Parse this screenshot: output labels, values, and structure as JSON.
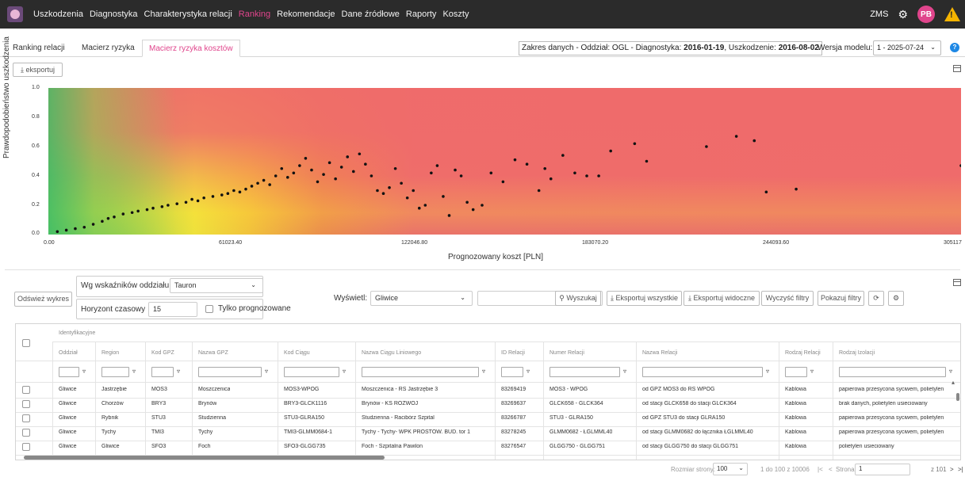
{
  "nav": {
    "items": [
      "Uszkodzenia",
      "Diagnostyka",
      "Charakterystyka relacji",
      "Ranking",
      "Rekomendacje",
      "Dane źródłowe",
      "Raporty",
      "Koszty"
    ],
    "active": "Ranking",
    "user_code": "ZMS",
    "avatar_initials": "PB",
    "warning_glyph": "!"
  },
  "tabs": [
    "Ranking relacji",
    "Macierz ryzyka",
    "Macierz ryzyka kosztów"
  ],
  "active_tab": "Macierz ryzyka kosztów",
  "range": {
    "prefix": "Zakres danych - Oddział: OGL - Diagnostyka: ",
    "diag_date": "2016-01-19",
    "mid": ", Uszkodzenie: ",
    "fail_date": "2016-08-02"
  },
  "model": {
    "label": "Wersja modelu:",
    "value": "1 - 2025-07-24"
  },
  "export_label": "eksportuj",
  "chart_data": {
    "type": "scatter",
    "xlabel": "Prognozowany koszt [PLN]",
    "ylabel": "Prawdopodobieństwo uszkodzenia",
    "xlim": [
      0,
      305117
    ],
    "ylim": [
      0,
      1
    ],
    "x_ticks": [
      "0.00",
      "61023.40",
      "122046.80",
      "183070.20",
      "244093.60",
      "305117"
    ],
    "y_ticks": [
      "1.0",
      "0.8",
      "0.6",
      "0.4",
      "0.2",
      "0.0"
    ],
    "points": [
      [
        3000,
        0.02
      ],
      [
        6000,
        0.03
      ],
      [
        9000,
        0.04
      ],
      [
        12000,
        0.05
      ],
      [
        15000,
        0.07
      ],
      [
        18000,
        0.09
      ],
      [
        20000,
        0.11
      ],
      [
        22000,
        0.12
      ],
      [
        25000,
        0.14
      ],
      [
        28000,
        0.15
      ],
      [
        30000,
        0.16
      ],
      [
        33000,
        0.17
      ],
      [
        35000,
        0.18
      ],
      [
        38000,
        0.19
      ],
      [
        40000,
        0.2
      ],
      [
        43000,
        0.21
      ],
      [
        46000,
        0.22
      ],
      [
        48000,
        0.24
      ],
      [
        50000,
        0.23
      ],
      [
        52000,
        0.25
      ],
      [
        55000,
        0.26
      ],
      [
        58000,
        0.27
      ],
      [
        60000,
        0.28
      ],
      [
        62000,
        0.3
      ],
      [
        64000,
        0.29
      ],
      [
        66000,
        0.31
      ],
      [
        68000,
        0.33
      ],
      [
        70000,
        0.35
      ],
      [
        72000,
        0.37
      ],
      [
        74000,
        0.34
      ],
      [
        76000,
        0.4
      ],
      [
        78000,
        0.45
      ],
      [
        80000,
        0.39
      ],
      [
        82000,
        0.42
      ],
      [
        84000,
        0.47
      ],
      [
        86000,
        0.52
      ],
      [
        88000,
        0.44
      ],
      [
        90000,
        0.36
      ],
      [
        92000,
        0.41
      ],
      [
        94000,
        0.49
      ],
      [
        96000,
        0.38
      ],
      [
        98000,
        0.46
      ],
      [
        100000,
        0.53
      ],
      [
        102000,
        0.43
      ],
      [
        104000,
        0.55
      ],
      [
        106000,
        0.48
      ],
      [
        108000,
        0.4
      ],
      [
        110000,
        0.3
      ],
      [
        112000,
        0.28
      ],
      [
        114000,
        0.32
      ],
      [
        116000,
        0.45
      ],
      [
        118000,
        0.35
      ],
      [
        120000,
        0.25
      ],
      [
        122000,
        0.3
      ],
      [
        124000,
        0.18
      ],
      [
        126000,
        0.2
      ],
      [
        128000,
        0.42
      ],
      [
        130000,
        0.47
      ],
      [
        132000,
        0.26
      ],
      [
        134000,
        0.13
      ],
      [
        136000,
        0.44
      ],
      [
        138000,
        0.4
      ],
      [
        140000,
        0.22
      ],
      [
        142000,
        0.17
      ],
      [
        145000,
        0.2
      ],
      [
        148000,
        0.42
      ],
      [
        152000,
        0.36
      ],
      [
        156000,
        0.51
      ],
      [
        160000,
        0.48
      ],
      [
        164000,
        0.3
      ],
      [
        166000,
        0.45
      ],
      [
        168000,
        0.38
      ],
      [
        172000,
        0.54
      ],
      [
        176000,
        0.42
      ],
      [
        180000,
        0.4
      ],
      [
        184000,
        0.4
      ],
      [
        188000,
        0.57
      ],
      [
        196000,
        0.62
      ],
      [
        200000,
        0.5
      ],
      [
        220000,
        0.6
      ],
      [
        230000,
        0.67
      ],
      [
        236000,
        0.64
      ],
      [
        240000,
        0.29
      ],
      [
        250000,
        0.31
      ],
      [
        305117,
        0.47
      ]
    ]
  },
  "controls": {
    "refresh_label": "Odśwież wykres",
    "indicator_label": "Wg wskaźników oddziału",
    "indicator_value": "Tauron",
    "horizon_label": "Horyzont czasowy",
    "horizon_value": "15",
    "forecast_only_label": "Tylko prognozowane",
    "show_label": "Wyświetl:",
    "show_value": "Gliwice",
    "search_label": "Wyszukaj",
    "export_all_label": "Eksportuj wszystkie",
    "export_visible_label": "Eksportuj widoczne",
    "clear_filters_label": "Wyczyść filtry",
    "show_filters_label": "Pokazuj filtry"
  },
  "table": {
    "group_header": "Identyfikacyjne",
    "columns": [
      "Oddział",
      "Region",
      "Kod GPZ",
      "Nazwa GPZ",
      "Kod Ciągu",
      "Nazwa Ciągu Liniowego",
      "ID Relacji",
      "Numer Relacji",
      "Nazwa Relacji",
      "Rodzaj Relacji",
      "Rodzaj Izolacji"
    ],
    "rows": [
      [
        "Gliwice",
        "Jastrzębie",
        "MOS3",
        "Moszczenica",
        "MOS3-WPOG",
        "Moszczenica - RS Jastrzębie 3",
        "83269419",
        "MOS3 - WPOG",
        "od GPZ MOS3 do RS WPOG",
        "Kablowa",
        "papierowa przesycona syciwem, polietylen"
      ],
      [
        "Gliwice",
        "Chorzów",
        "BRY3",
        "Brynów",
        "BRY3-GLCK1116",
        "Brynów - KS ROZWÓJ",
        "83269637",
        "GLCK658 - GLCK364",
        "od stacji GLCK658 do stacji GLCK364",
        "Kablowa",
        "brak danych, polietylen usieciowany"
      ],
      [
        "Gliwice",
        "Rybnik",
        "STU3",
        "Studzienna",
        "STU3-GLRA150",
        "Studzienna - Racibórz Szpital",
        "83266787",
        "STU3 - GLRA150",
        "od GPZ STU3 do stacji GLRA150",
        "Kablowa",
        "papierowa przesycona syciwem, polietylen"
      ],
      [
        "Gliwice",
        "Tychy",
        "TMI3",
        "Tychy",
        "TMI3-GLMM0684-1",
        "Tychy - Tychy- WPK PROSTOW. BUD. tor 1",
        "83278245",
        "GLMM0682 - ŁGLMML40",
        "od stacji GLMM0682 do łącznika ŁGLMML40",
        "Kablowa",
        "papierowa przesycona syciwem, polietylen"
      ],
      [
        "Gliwice",
        "Gliwice",
        "SFO3",
        "Foch",
        "SFO3-GLGG735",
        "Foch - Szpitalna Pawilon",
        "83276547",
        "GLGG750 - GLGG751",
        "od stacji GLGG750 do stacji GLGG751",
        "Kablowa",
        "polietylen usieciowany"
      ]
    ]
  },
  "pager": {
    "page_size_label": "Rozmiar strony:",
    "page_size": "100",
    "range_text": "1 do 100 z 10006",
    "page_label": "Strona",
    "page_value": "1",
    "of_text": "z 101"
  }
}
